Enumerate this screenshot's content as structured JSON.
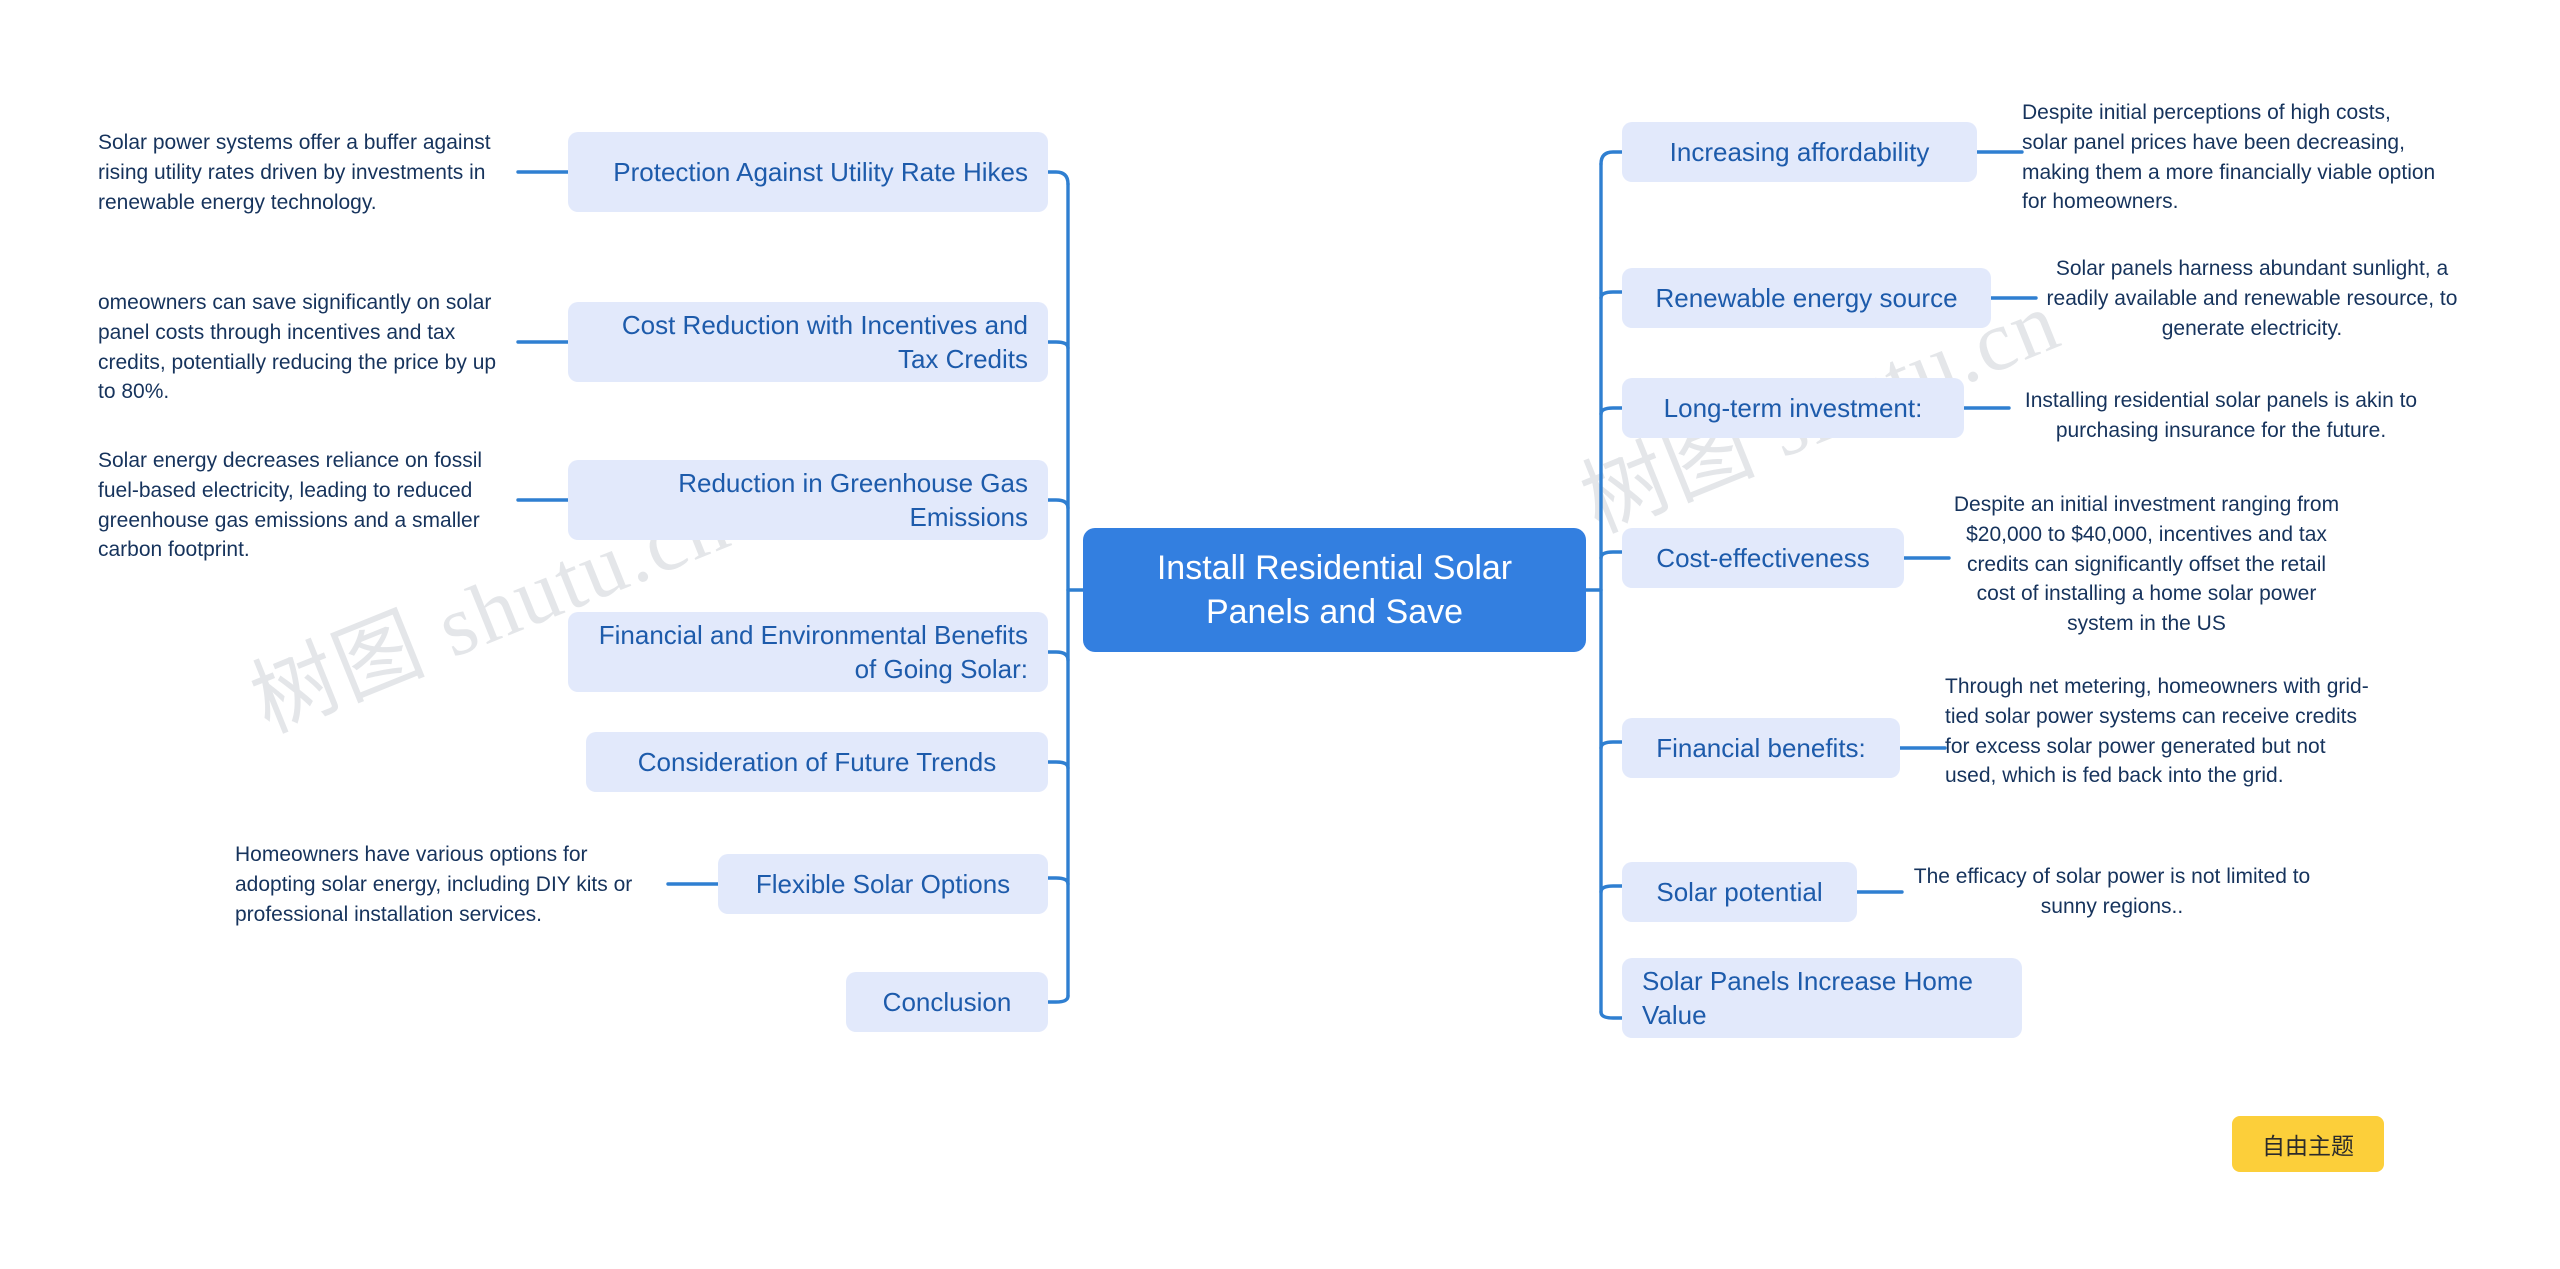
{
  "map": {
    "center": {
      "label": "Install Residential Solar Panels and Save"
    },
    "left_branch": [
      {
        "id": "protection-utility-rate-hikes",
        "label": "Protection Against Utility Rate Hikes",
        "detail": "Solar power systems offer a buffer against rising utility rates driven by investments in renewable energy technology."
      },
      {
        "id": "cost-reduction-incentives",
        "label": "Cost Reduction with Incentives and Tax Credits",
        "detail": "omeowners can save significantly on solar panel costs through incentives and tax credits, potentially reducing the price by up to 80%."
      },
      {
        "id": "reduction-greenhouse-gas",
        "label": "Reduction in Greenhouse Gas Emissions",
        "detail": "Solar energy decreases reliance on fossil fuel-based electricity, leading to reduced greenhouse gas emissions and a smaller carbon footprint."
      },
      {
        "id": "financial-environmental-benefits",
        "label": "Financial and Environmental Benefits of Going Solar:",
        "detail": ""
      },
      {
        "id": "consideration-future-trends",
        "label": "Consideration of Future Trends",
        "detail": ""
      },
      {
        "id": "flexible-solar-options",
        "label": "Flexible Solar Options",
        "detail": "Homeowners have various options for adopting solar energy, including DIY kits or professional installation services."
      },
      {
        "id": "conclusion",
        "label": "Conclusion",
        "detail": ""
      }
    ],
    "right_branch": [
      {
        "id": "increasing-affordability",
        "label": "Increasing affordability",
        "detail": "Despite initial perceptions of high costs, solar panel prices have been decreasing, making them a more financially viable option for homeowners."
      },
      {
        "id": "renewable-energy-source",
        "label": "Renewable energy source",
        "detail": "Solar panels harness abundant sunlight, a readily available and renewable resource, to generate electricity."
      },
      {
        "id": "long-term-investment",
        "label": "Long-term investment:",
        "detail": "Installing residential solar panels is akin to purchasing insurance for the future."
      },
      {
        "id": "cost-effectiveness",
        "label": "Cost-effectiveness",
        "detail": "Despite an initial investment ranging from $20,000 to $40,000, incentives and tax credits can significantly offset the retail cost of installing a home solar power system in the US"
      },
      {
        "id": "financial-benefits",
        "label": "Financial benefits:",
        "detail": "Through net metering, homeowners with grid-tied solar power systems can receive  credits for excess solar power generated but not used, which is fed back into the grid."
      },
      {
        "id": "solar-potential",
        "label": "Solar potential",
        "detail": "The efficacy of solar power is not limited to sunny regions.."
      },
      {
        "id": "solar-panels-home-value",
        "label": "Solar Panels Increase Home Value",
        "detail": ""
      }
    ]
  },
  "toolbar": {
    "free_theme_label": "自由主题"
  },
  "watermark": {
    "text": "树图 shutu.cn"
  },
  "colors": {
    "center_fill": "#337fe0",
    "node_fill": "#e2e9fb",
    "node_text": "#1d5bab",
    "leaf_text": "#16335c",
    "connector": "#2f7fd1",
    "accent_button": "#fccf3a"
  }
}
